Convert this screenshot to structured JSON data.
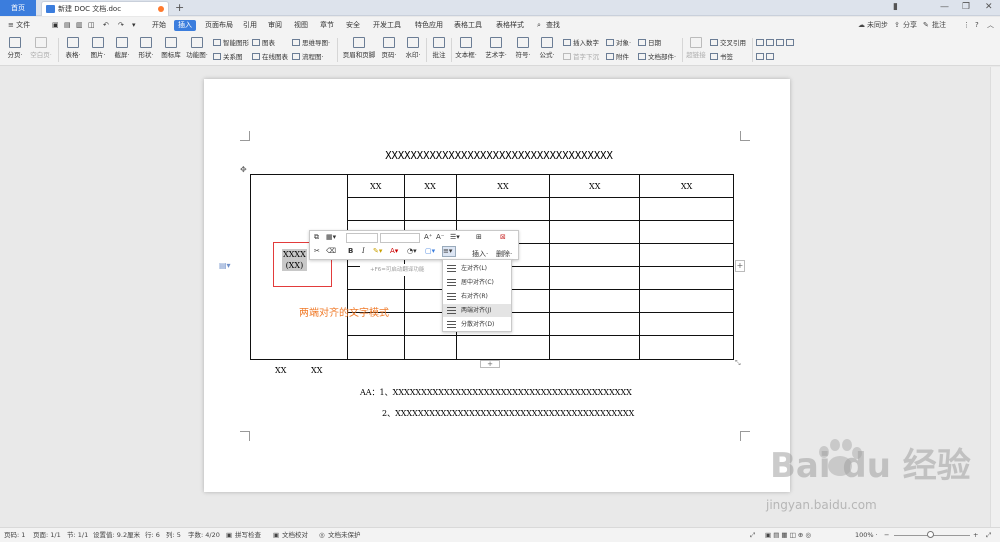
{
  "titlebar": {
    "home_tab": "首页",
    "doc_tab": "新建 DOC 文档.doc",
    "add_tab": "+"
  },
  "menubar": {
    "file": "≡ 文件",
    "items": [
      "开始",
      "插入",
      "页面布局",
      "引用",
      "审阅",
      "视图",
      "章节",
      "安全",
      "开发工具",
      "特色应用",
      "表格工具",
      "表格样式"
    ],
    "active": "插入",
    "search": "查找",
    "sync": "未同步",
    "share": "分享",
    "comment": "批注"
  },
  "ribbon": {
    "big": [
      {
        "label": "分页·"
      },
      {
        "label": "空白页·"
      },
      {
        "label": "表格·"
      },
      {
        "label": "图片·"
      },
      {
        "label": "截屏·"
      },
      {
        "label": "形状·"
      },
      {
        "label": "图标库"
      },
      {
        "label": "功能图·"
      },
      {
        "label": "页眉和页脚"
      },
      {
        "label": "页码·"
      },
      {
        "label": "水印·"
      },
      {
        "label": "批注"
      },
      {
        "label": "文本框·"
      },
      {
        "label": "艺术字·"
      },
      {
        "label": "符号·"
      },
      {
        "label": "公式·"
      }
    ],
    "small": [
      "智能图形",
      "图表",
      "思维导图·",
      "关系图",
      "在线图表",
      "流程图·",
      "插入数字",
      "对象·",
      "日期",
      "首字下沉",
      "附件",
      "文档部件·",
      "超链接",
      "交叉引用",
      "书签"
    ]
  },
  "document": {
    "title": "XXXXXXXXXXXXXXXXXXXXXXXXXXXXXXXXXXXX",
    "header_row": [
      "XX",
      "XX",
      "XX",
      "XX",
      "XX"
    ],
    "selected_cell": "XXXX\n(XX)",
    "selected_line1": "XXXX",
    "selected_line2": "(XX)",
    "annotation": "两端对齐的文字模式",
    "below_left": "XX",
    "below_right": "XX",
    "note1": "AA：1、XXXXXXXXXXXXXXXXXXXXXXXXXXXXXXXXXXXXXXXXXX",
    "note2": "2、XXXXXXXXXXXXXXXXXXXXXXXXXXXXXXXXXXXXXXXXXX"
  },
  "mini_toolbar": {
    "insert": "插入·",
    "delete": "删除·",
    "bold": "B",
    "italic": "I",
    "hint": "+F6=可启动翻译功能"
  },
  "align_menu": [
    {
      "label": "左对齐(L)"
    },
    {
      "label": "居中对齐(C)"
    },
    {
      "label": "右对齐(R)"
    },
    {
      "label": "两端对齐(J)"
    },
    {
      "label": "分散对齐(D)"
    }
  ],
  "statusbar": {
    "page": "页码: 1",
    "pages": "页面: 1/1",
    "section": "节: 1/1",
    "setting": "设置值: 9.2厘米",
    "row": "行: 6",
    "col": "列: 5",
    "words": "字数: 4/20",
    "spell": "拼写检查",
    "proof": "文档校对",
    "protect": "文档未保护",
    "zoom": "100% ·"
  },
  "watermark": {
    "text": "Bai du 经验",
    "url": "jingyan.baidu.com"
  }
}
